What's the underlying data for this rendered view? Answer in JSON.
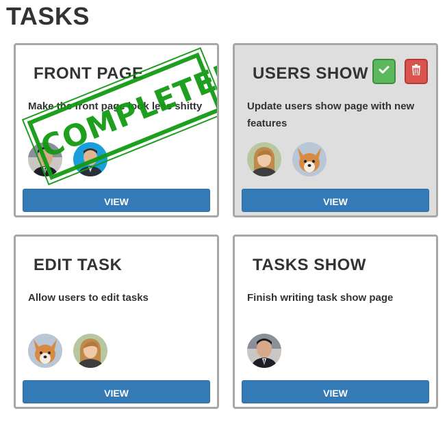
{
  "page": {
    "title": "TASKS"
  },
  "tasks": [
    {
      "title": "FRONT PAGE",
      "description": "Make the front page look less shitty",
      "stamp": "COMPLETED",
      "avatars": [
        "man-suit",
        "man-blue"
      ],
      "view_label": "VIEW"
    },
    {
      "title": "USERS SHOW",
      "description": "Update users show page with new features",
      "avatars": [
        "woman",
        "corgi"
      ],
      "view_label": "VIEW",
      "actions": {
        "complete_icon": "checkmark-icon",
        "delete_icon": "trash-icon"
      }
    },
    {
      "title": "EDIT TASK",
      "description": "Allow users to edit tasks",
      "avatars": [
        "corgi",
        "woman"
      ],
      "view_label": "VIEW"
    },
    {
      "title": "TASKS SHOW",
      "description": "Finish writing task show page",
      "avatars": [
        "man-suit"
      ],
      "view_label": "VIEW"
    }
  ],
  "colors": {
    "primary": "#337ab7",
    "success": "#5cb85c",
    "danger": "#d9534f",
    "stamp": "#139a13",
    "card_border": "#a7a7a7",
    "highlight_bg": "#dedede"
  }
}
